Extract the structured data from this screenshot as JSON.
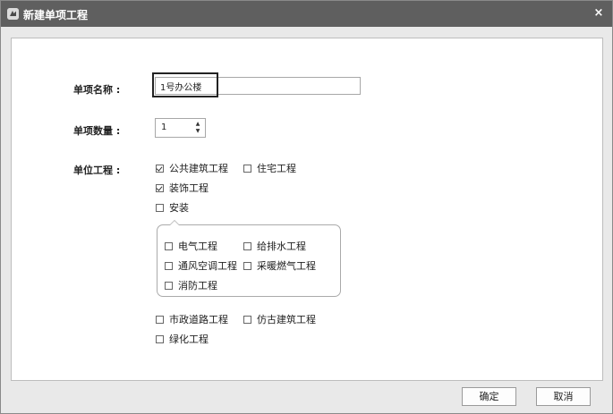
{
  "window": {
    "title": "新建单项工程",
    "close_glyph": "×"
  },
  "form": {
    "name_label": "单项名称 :",
    "name_value": "1号办公楼",
    "quantity_label": "单项数量 :",
    "quantity_value": "1",
    "unit_label": "单位工程 :"
  },
  "units": {
    "public_building": {
      "label": "公共建筑工程",
      "checked": true
    },
    "residential": {
      "label": "住宅工程",
      "checked": false
    },
    "decoration": {
      "label": "装饰工程",
      "checked": true
    },
    "installation": {
      "label": "安装",
      "checked": false
    },
    "municipal_road": {
      "label": "市政道路工程",
      "checked": false
    },
    "antique_building": {
      "label": "仿古建筑工程",
      "checked": false
    },
    "greening": {
      "label": "绿化工程",
      "checked": false
    }
  },
  "install_sub": {
    "electrical": {
      "label": "电气工程",
      "checked": false
    },
    "plumbing": {
      "label": "给排水工程",
      "checked": false
    },
    "hvac": {
      "label": "通风空调工程",
      "checked": false
    },
    "heating_gas": {
      "label": "采暖燃气工程",
      "checked": false
    },
    "fire": {
      "label": "消防工程",
      "checked": false
    }
  },
  "buttons": {
    "ok": "确定",
    "cancel": "取消"
  },
  "icons": {
    "app": "app-logo-icon",
    "close": "close-icon",
    "spin_up": "triangle-up-icon",
    "spin_down": "triangle-down-icon"
  },
  "colors": {
    "titlebar": "#5f5f5f",
    "dialog_bg": "#e9e9e9",
    "content_bg": "#ffffff",
    "highlight_border": "#222222"
  }
}
